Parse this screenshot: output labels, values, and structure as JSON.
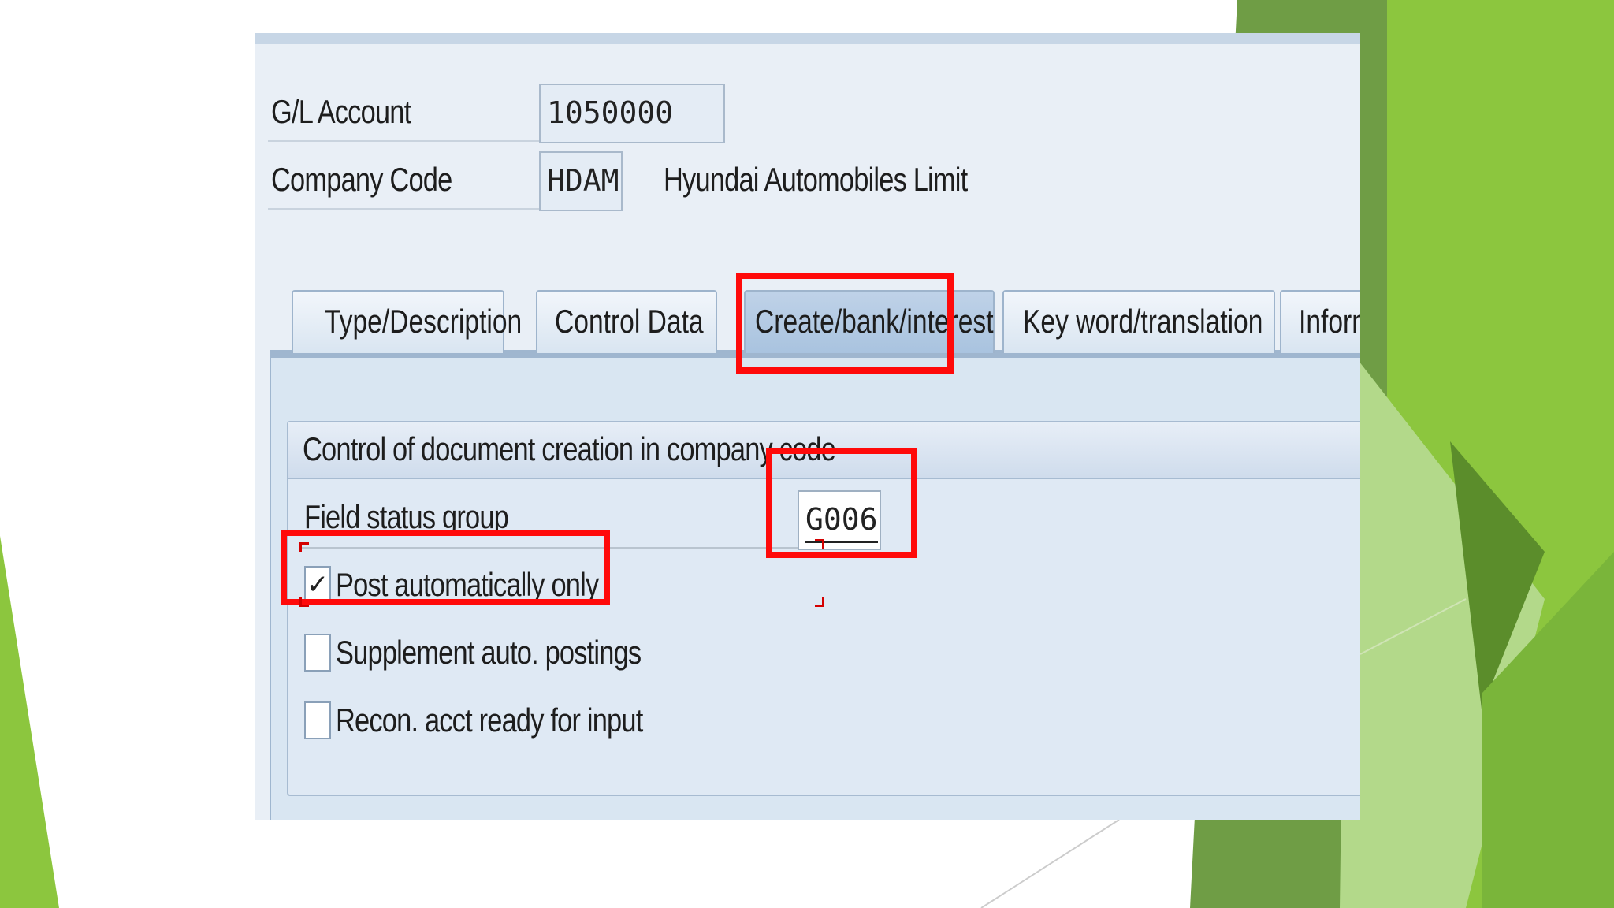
{
  "colors": {
    "accent_green": "#8dc63f",
    "dark_green": "#5f9a2e",
    "highlight_red": "#ff0a0a"
  },
  "header": {
    "gl_account_label": "G/L Account",
    "gl_account_value": "1050000",
    "company_code_label": "Company Code",
    "company_code_value": "HDAM",
    "company_name": "Hyundai Automobiles Limit"
  },
  "tabs": [
    {
      "label": "Type/Description"
    },
    {
      "label": "Control Data"
    },
    {
      "label": "Create/bank/interest"
    },
    {
      "label": "Key word/translation"
    },
    {
      "label": "Inform"
    }
  ],
  "group": {
    "title": "Control of document creation in company code",
    "field_status_label": "Field status group",
    "field_status_value": "G006",
    "checkboxes": [
      {
        "label": "Post automatically only",
        "checked": true,
        "mark": "✓"
      },
      {
        "label": "Supplement auto. postings",
        "checked": false
      },
      {
        "label": "Recon. acct ready for input",
        "checked": false
      }
    ]
  }
}
